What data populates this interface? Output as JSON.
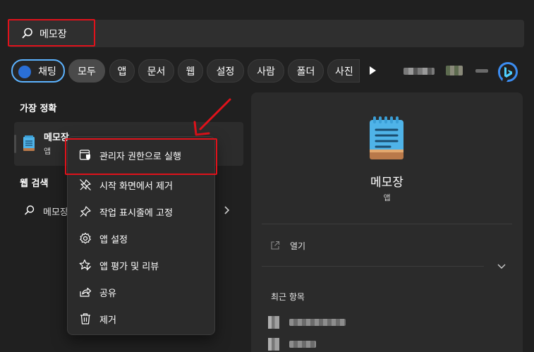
{
  "search": {
    "value": "메모장"
  },
  "filters": {
    "chips": [
      "채팅",
      "모두",
      "앱",
      "문서",
      "웹",
      "설정",
      "사람",
      "폴더",
      "사진"
    ],
    "selected": "모두"
  },
  "best_match": {
    "section_title": "가장 정확",
    "name": "메모장",
    "type": "앱"
  },
  "web_search": {
    "section_title": "웹 검색",
    "query": "메모장"
  },
  "context_menu": {
    "items": [
      {
        "label": "관리자 권한으로 실행",
        "icon": "shield-window-icon"
      },
      {
        "label": "시작 화면에서 제거",
        "icon": "unpin-icon"
      },
      {
        "label": "작업 표시줄에 고정",
        "icon": "pin-icon"
      },
      {
        "label": "앱 설정",
        "icon": "gear-icon"
      },
      {
        "label": "앱 평가 및 리뷰",
        "icon": "star-edit-icon"
      },
      {
        "label": "공유",
        "icon": "share-icon"
      },
      {
        "label": "제거",
        "icon": "trash-icon"
      }
    ]
  },
  "details": {
    "title": "메모장",
    "subtitle": "앱",
    "open_label": "열기",
    "recent_title": "최근 항목"
  },
  "colors": {
    "background": "#202020",
    "panel": "#2b2b2b",
    "highlight_red": "#e0121b",
    "accent_blue": "#5cb3ff",
    "notepad_blue": "#4fb3e8"
  }
}
